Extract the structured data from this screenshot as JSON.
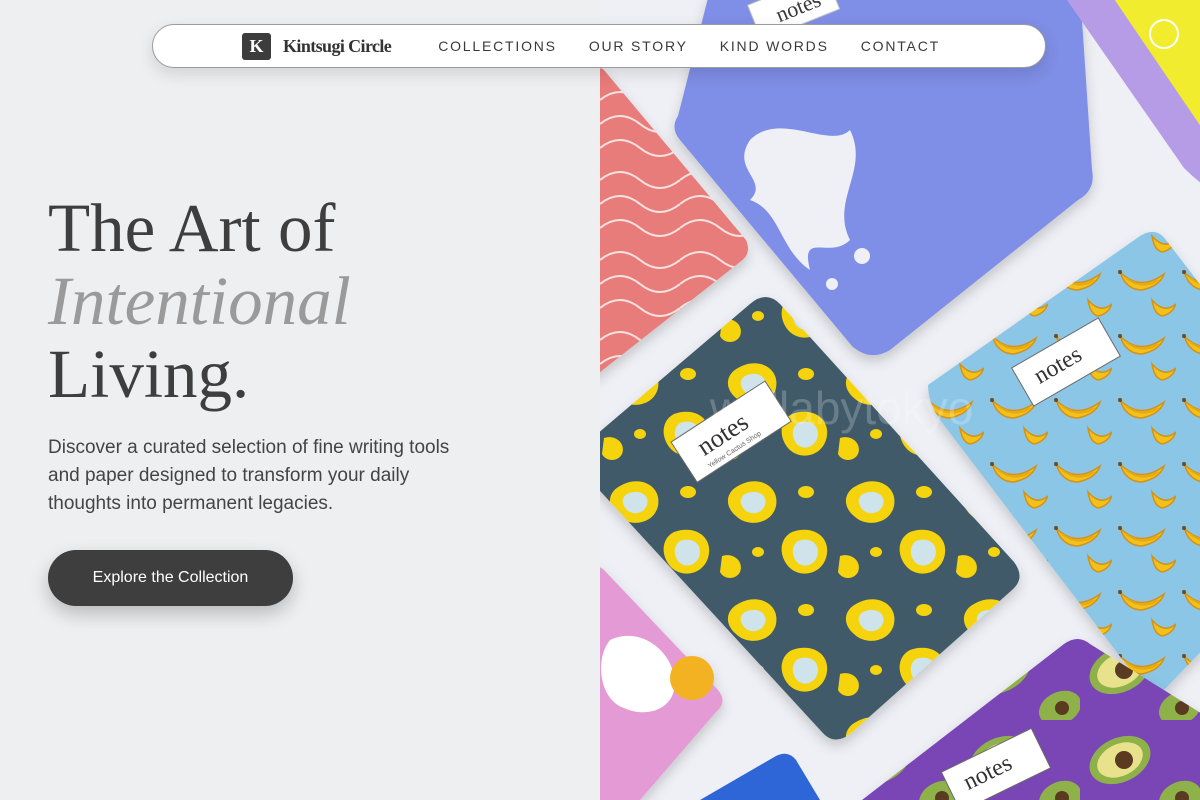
{
  "brand": {
    "mark": "K",
    "name": "Kintsugi Circle"
  },
  "nav": {
    "items": [
      {
        "label": "COLLECTIONS"
      },
      {
        "label": "OUR STORY"
      },
      {
        "label": "KIND WORDS"
      },
      {
        "label": "CONTACT"
      }
    ]
  },
  "hero": {
    "title_line1": "The Art of",
    "title_line2": "Intentional",
    "title_line3": "Living.",
    "description": "Discover a curated selection of fine writing tools and paper designed to transform your daily thoughts into permanent legacies.",
    "cta_label": "Explore the Collection"
  },
  "image": {
    "notebook_label": "notes",
    "notebook_sublabel": "Yellow Cactus Shop",
    "watermark": "wallabytokyo"
  },
  "colors": {
    "background": "#eeeff1",
    "text_dark": "#3e3e3e",
    "text_muted": "#9a9a9a",
    "button": "#3e3e3e"
  }
}
